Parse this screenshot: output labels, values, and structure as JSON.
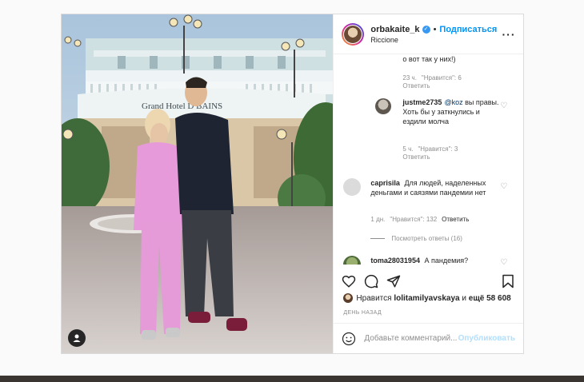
{
  "header": {
    "username": "orbakaite_k",
    "follow_label": "Подписаться",
    "separator": "•",
    "location": "Riccione",
    "more_icon": "more-horizontal-icon"
  },
  "photo": {
    "sign_text": "Grand Hotel D  BAINS"
  },
  "comments": {
    "c0_text_tail": "о вот так у них!)",
    "c0_time": "23 ч.",
    "c0_likes": "\"Нравится\": 6",
    "c0_reply": "Ответить",
    "c1_user": "justme2735",
    "c1_mention": "@koz",
    "c1_text": "вы правы. Хоть бы у заткнулись и ездили молча",
    "c1_time": "5 ч.",
    "c1_likes": "\"Нравится\": 3",
    "c1_reply": "Ответить",
    "c2_user": "caprisila",
    "c2_text": "Для людей, наделенных деньгами и саязями пандемии нет",
    "c2_time": "1 дн.",
    "c2_likes": "\"Нравится\": 132",
    "c2_reply": "Ответить",
    "c2_view_replies": "Посмотреть ответы (16)",
    "c3_user": "toma28031954",
    "c3_text": "А пандемия?"
  },
  "likes": {
    "prefix": "Нравится",
    "user": "lolitamilyavskaya",
    "conj": "и",
    "others": "ещё 58 608"
  },
  "date": "ДЕНЬ НАЗАД",
  "add_comment": {
    "placeholder": "Добавьте комментарий...",
    "post_label": "Опубликовать"
  },
  "colors": {
    "accent": "#0095f6",
    "verified": "#3897f0",
    "muted": "#8e8e8e"
  }
}
